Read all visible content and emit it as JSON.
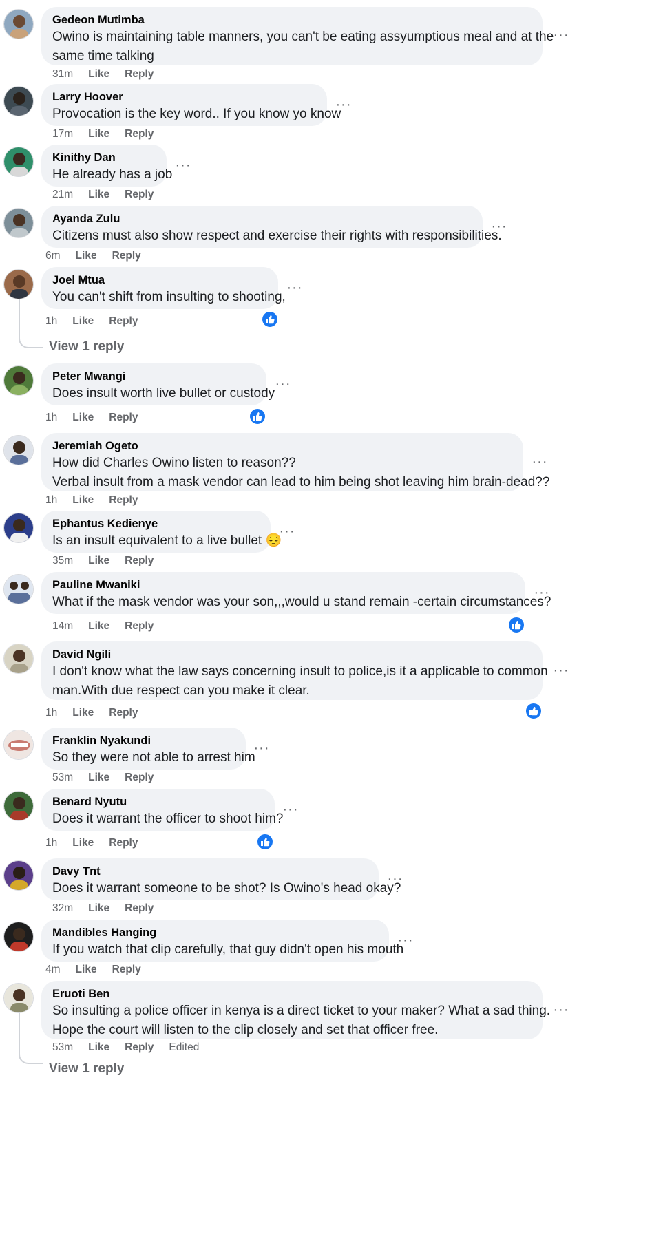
{
  "comments": [
    {
      "author": "Gedeon Mutimba",
      "lines": [
        "Owino is maintaining table manners, you can't be eating assyumptious meal and at the",
        "same time talking"
      ],
      "time": "31m",
      "like": "Like",
      "reply": "Reply",
      "avatar": "#8fa8c0"
    },
    {
      "author": "Larry Hoover",
      "lines": [
        "Provocation is the key word.. If you know yo know"
      ],
      "time": "17m",
      "like": "Like",
      "reply": "Reply",
      "avatar": "#3d4a52"
    },
    {
      "author": "Kinithy Dan",
      "lines": [
        "He already has a job"
      ],
      "time": "21m",
      "like": "Like",
      "reply": "Reply",
      "avatar": "#2f8f6a"
    },
    {
      "author": "Ayanda Zulu",
      "lines": [
        "Citizens must also show respect and exercise their rights with responsibilities."
      ],
      "time": "6m",
      "like": "Like",
      "reply": "Reply",
      "avatar": "#7d8f99"
    },
    {
      "author": "Joel Mtua",
      "lines": [
        "You can't shift from insulting to shooting,"
      ],
      "time": "1h",
      "like": "Like",
      "reply": "Reply",
      "avatar": "#9a6a4a"
    },
    {
      "author": "Peter Mwangi",
      "lines": [
        "Does insult worth live bullet or custody"
      ],
      "time": "1h",
      "like": "Like",
      "reply": "Reply",
      "avatar": "#4f7a3a"
    },
    {
      "author": "Jeremiah Ogeto",
      "lines": [
        "How did Charles Owino listen to reason??",
        "Verbal insult from a mask vendor can lead to him being shot leaving him brain-dead??"
      ],
      "time": "1h",
      "like": "Like",
      "reply": "Reply",
      "avatar": "#b7bcc6"
    },
    {
      "author": "Ephantus Kedienye",
      "lines": [
        "Is an insult equivalent to a live bullet 😔"
      ],
      "time": "35m",
      "like": "Like",
      "reply": "Reply",
      "avatar": "#2c3e8a"
    },
    {
      "author": "Pauline Mwaniki",
      "lines": [
        "What if the mask vendor was your son,,,would u stand remain -certain circumstances?"
      ],
      "time": "14m",
      "like": "Like",
      "reply": "Reply",
      "avatar": "#5a6f9a"
    },
    {
      "author": "David Ngili",
      "lines": [
        "I don't know what the law says concerning insult to police,is it a applicable to common",
        "man.With due respect can you make it clear."
      ],
      "time": "1h",
      "like": "Like",
      "reply": "Reply",
      "avatar": "#a8a18a"
    },
    {
      "author": "Franklin Nyakundi",
      "lines": [
        "So they were not able to arrest him"
      ],
      "time": "53m",
      "like": "Like",
      "reply": "Reply",
      "avatar": "#d9c6c0"
    },
    {
      "author": "Benard Nyutu",
      "lines": [
        "Does it warrant the officer to shoot him?"
      ],
      "time": "1h",
      "like": "Like",
      "reply": "Reply",
      "avatar": "#a83a2a"
    },
    {
      "author": "Davy Tnt",
      "lines": [
        "Does it warrant someone to be shot? Is Owino's head okay?"
      ],
      "time": "32m",
      "like": "Like",
      "reply": "Reply",
      "avatar": "#5b3f8a"
    },
    {
      "author": "Mandibles Hanging",
      "lines": [
        "If you watch that clip carefully, that guy didn't open his mouth"
      ],
      "time": "4m",
      "like": "Like",
      "reply": "Reply",
      "avatar": "#c0392b"
    },
    {
      "author": "Eruoti Ben",
      "lines": [
        "So insulting a police officer in kenya is a direct ticket to your maker? What a sad thing.",
        "Hope the court will listen to the clip closely and set that officer free."
      ],
      "time": "53m",
      "like": "Like",
      "reply": "Reply",
      "edited": "Edited",
      "avatar": "#8a8a6a"
    }
  ],
  "view_reply_label": "View 1 reply",
  "more_icon": "···",
  "colors": {
    "bubble": "#f0f2f5",
    "like_blue": "#1877f2",
    "meta": "#65676b"
  }
}
